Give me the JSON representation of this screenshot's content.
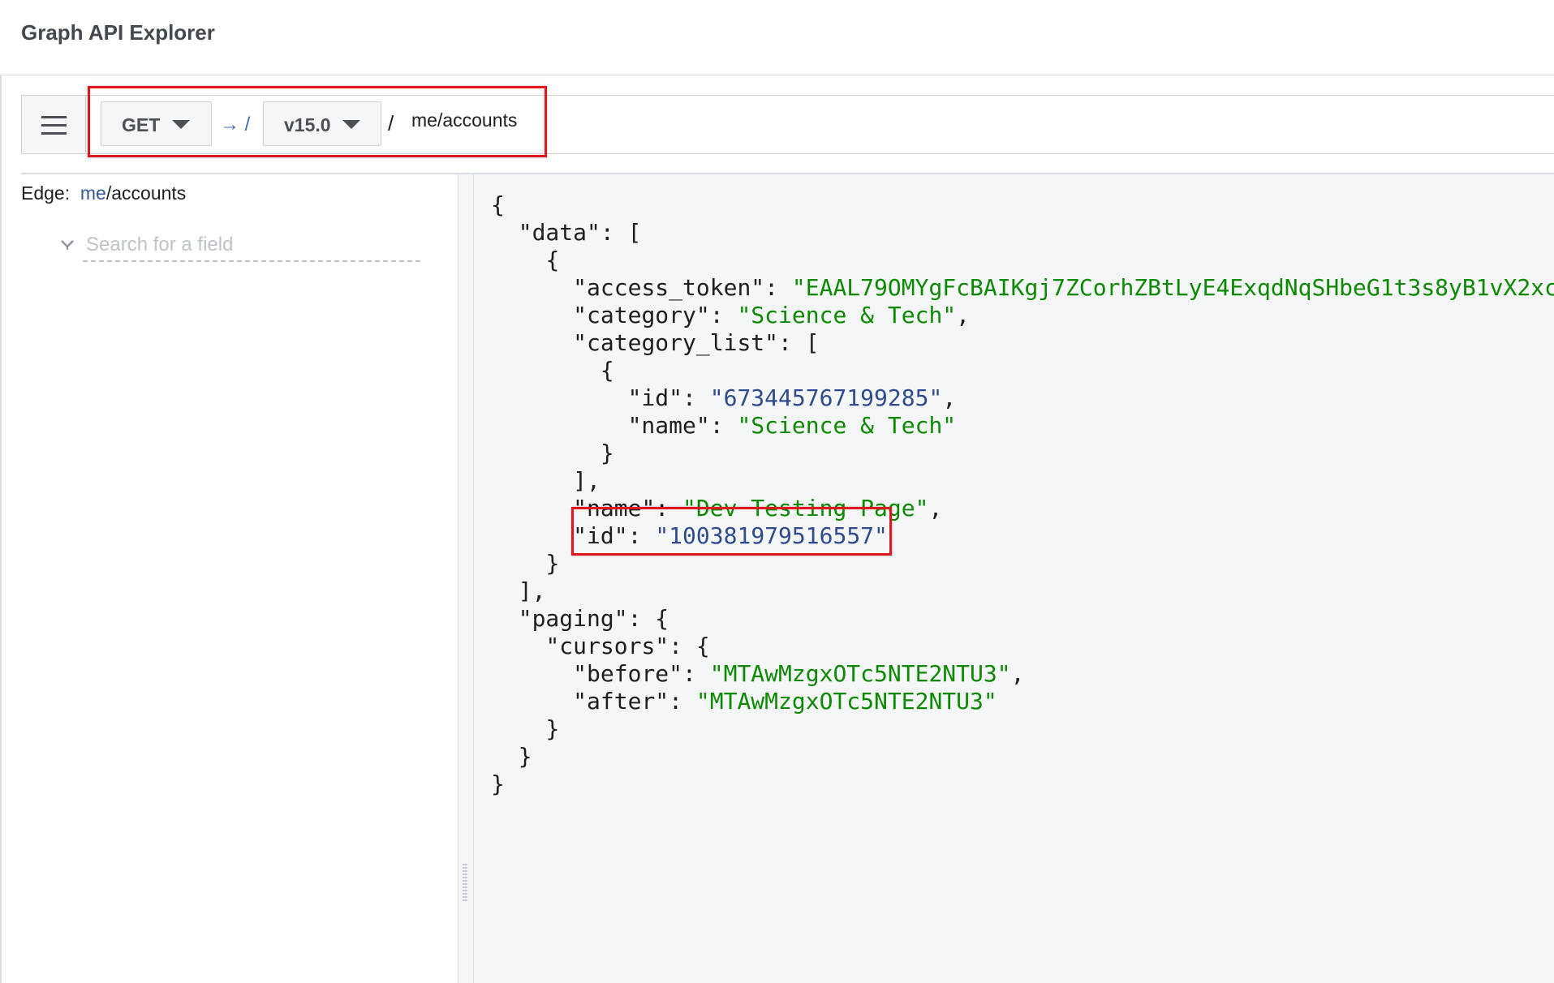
{
  "app": {
    "title": "Graph API Explorer"
  },
  "query": {
    "method": "GET",
    "arrow": "→ /",
    "version": "v15.0",
    "slash": "/",
    "path": "me/accounts"
  },
  "field_panel": {
    "edge_label": "Edge:",
    "edge_link": "me",
    "edge_rest": "/accounts",
    "search_placeholder": "Search for a field"
  },
  "response": {
    "brace_open": "{",
    "data_key": "\"data\": [",
    "item_open": "{",
    "access_token_key": "\"access_token\": ",
    "access_token_value": "\"EAAL79OMYgFcBAIKgj7ZCorhZBtLyE4ExqdNqSHbeG1t3s8yB1vX2xc",
    "category_key": "\"category\": ",
    "category_value": "\"Science & Tech\"",
    "category_list_key": "\"category_list\": [",
    "cat_item_open": "{",
    "cat_id_key": "\"id\": ",
    "cat_id_value": "\"673445767199285\"",
    "cat_name_key": "\"name\": ",
    "cat_name_value": "\"Science & Tech\"",
    "cat_item_close": "}",
    "category_list_close": "],",
    "name_key": "\"name\": ",
    "name_value": "\"Dev Testing Page\"",
    "id_key": "\"id\": ",
    "id_value": "\"100381979516557\"",
    "item_close": "}",
    "data_close": "],",
    "paging_key": "\"paging\": {",
    "cursors_key": "\"cursors\": {",
    "before_key": "\"before\": ",
    "before_value": "\"MTAwMzgxOTc5NTE2NTU3\"",
    "after_key": "\"after\": ",
    "after_value": "\"MTAwMzgxOTc5NTE2NTU3\"",
    "cursors_close": "}",
    "paging_close": "}",
    "brace_close": "}"
  },
  "colors": {
    "highlight": "#e0161f",
    "json_string": "#0b8a00",
    "json_number": "#2e4b8f"
  },
  "icons": {
    "menu": "hamburger-icon",
    "caret": "caret-down-icon",
    "search": "search-chevron-icon"
  }
}
